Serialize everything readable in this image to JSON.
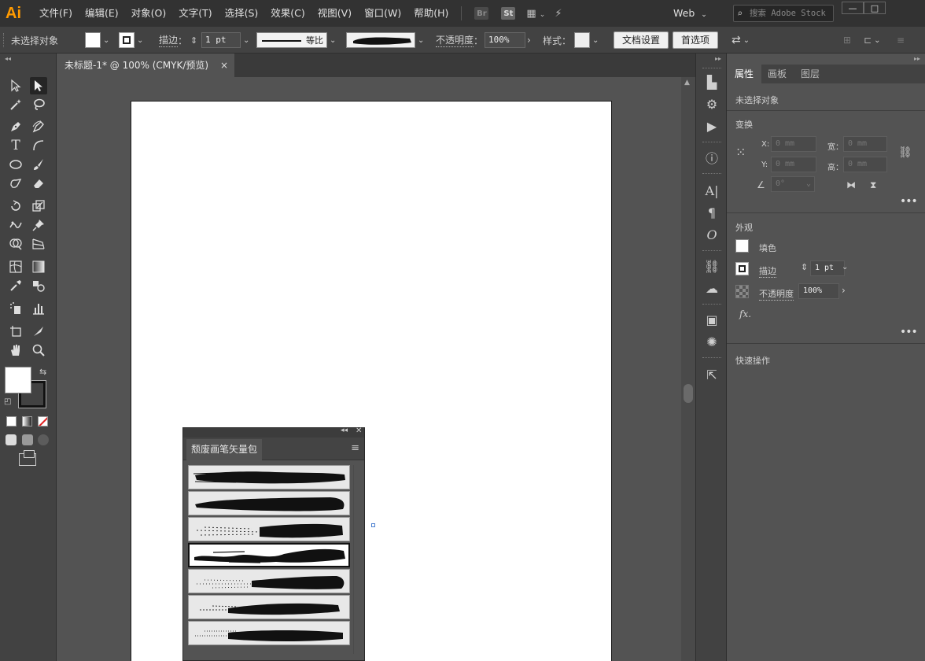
{
  "app": {
    "logo": "Ai",
    "menu": [
      "文件(F)",
      "编辑(E)",
      "对象(O)",
      "文字(T)",
      "选择(S)",
      "效果(C)",
      "视图(V)",
      "窗口(W)",
      "帮助(H)"
    ],
    "bridge_label": "Br",
    "stock_label": "St",
    "workspace": "Web",
    "search_placeholder": "搜索 Adobe Stock",
    "window_buttons": [
      "—",
      "□"
    ]
  },
  "control_bar": {
    "selection_status": "未选择对象",
    "stroke_label": "描边",
    "stroke_weight": "1 pt",
    "profile_label": "等比",
    "opacity_label": "不透明度",
    "opacity_value": "100%",
    "style_label": "样式",
    "doc_setup_button": "文档设置",
    "preferences_button": "首选项"
  },
  "document": {
    "tab_title": "未标题-1* @ 100% (CMYK/预览)",
    "close_glyph": "×"
  },
  "brush_panel": {
    "title": "颓废画笔矢量包",
    "brushes": [
      {
        "name": "brush-1"
      },
      {
        "name": "brush-2"
      },
      {
        "name": "brush-3"
      },
      {
        "name": "brush-4",
        "selected": true
      },
      {
        "name": "brush-5"
      },
      {
        "name": "brush-6"
      },
      {
        "name": "brush-7"
      }
    ]
  },
  "properties": {
    "tabs": [
      "属性",
      "画板",
      "图层"
    ],
    "active_tab": "属性",
    "selection_status": "未选择对象",
    "transform": {
      "title": "变换",
      "x_label": "X:",
      "x_value": "0 mm",
      "y_label": "Y:",
      "y_value": "0 mm",
      "w_label": "宽：",
      "w_value": "0 mm",
      "h_label": "高：",
      "h_value": "0 mm",
      "angle_value": "0°"
    },
    "appearance": {
      "title": "外观",
      "fill_label": "填色",
      "stroke_label": "描边",
      "stroke_value": "1 pt",
      "opacity_label": "不透明度",
      "opacity_value": "100%",
      "fx_label": "fx."
    },
    "quick_actions": "快速操作"
  },
  "colors": {
    "accent": "#ff9a00",
    "ui_dark": "#323232",
    "ui_mid": "#424242",
    "ui_bg": "#535353"
  }
}
